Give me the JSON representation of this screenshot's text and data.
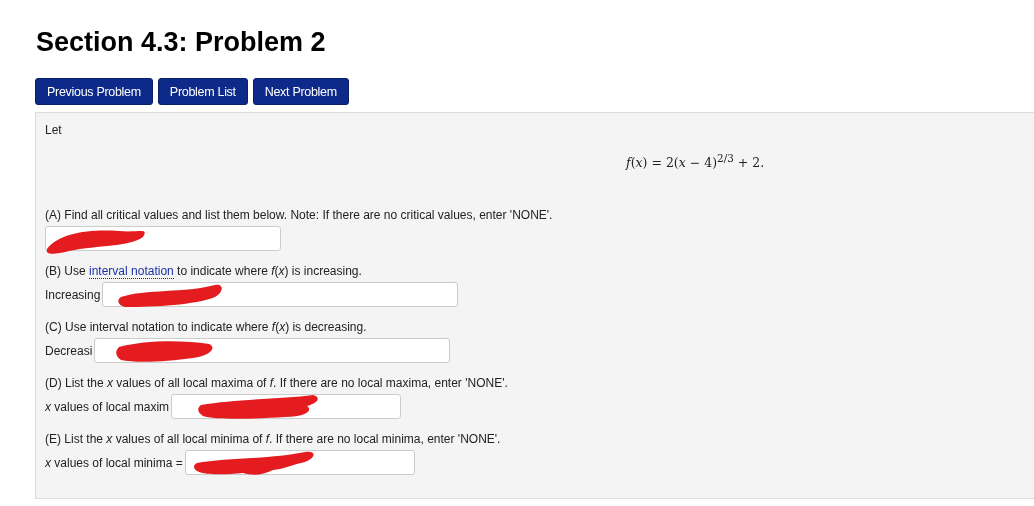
{
  "title": "Section 4.3: Problem 2",
  "nav_buttons": [
    "Previous Problem",
    "Problem List",
    "Next Problem"
  ],
  "intro": "Let",
  "formula": "*f*(*x*) = 2(*x* − 4)$^{2/3}$ + 2.",
  "parts": [
    {
      "before": "(A) Find all critical values and list them below. Note: If there are no critical values, enter 'NONE'.",
      "redacted": true
    },
    {
      "before": "(B) Use ",
      "link": "interval notation",
      "after": " to indicate where *f*(*x*) is increasing.",
      "label": "Increasing",
      "redacted": true
    },
    {
      "before": "(C) Use interval notation to indicate where *f*(*x*) is decreasing.",
      "label": "Decreasi",
      "redacted": true
    },
    {
      "before": "(D) List the *x* values of all local maxima of *f*. If there are no local maxima, enter 'NONE'.",
      "label": "*x* values of local maxim",
      "redacted": true
    },
    {
      "before": "(E) List the *x* values of all local minima of *f*. If there are no local minima, enter 'NONE'.",
      "label": "*x* values of local minima =",
      "redacted": true
    }
  ]
}
